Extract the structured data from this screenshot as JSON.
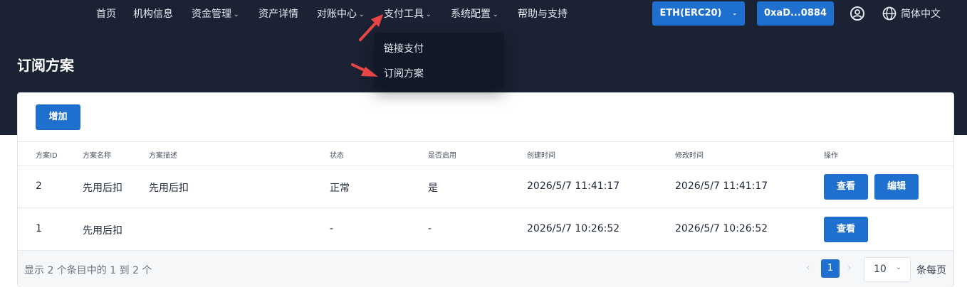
{
  "nav": {
    "items": [
      {
        "label": "首页"
      },
      {
        "label": "机构信息"
      },
      {
        "label": "资金管理",
        "caret": "⌄"
      },
      {
        "label": "资产详情"
      },
      {
        "label": "对账中心",
        "caret": "⌄"
      },
      {
        "label": "支付工具",
        "caret": "⌄"
      },
      {
        "label": "系统配置",
        "caret": "⌄"
      },
      {
        "label": "帮助与支持"
      }
    ],
    "network": {
      "label": "ETH(ERC20)",
      "caret": "⌄"
    },
    "wallet": {
      "label": "0xaD...0884"
    },
    "language": {
      "label": "简体中文",
      "icon": "globe-icon"
    },
    "user_icon": "user-circle-icon"
  },
  "dropdown": {
    "items": [
      {
        "label": "链接支付"
      },
      {
        "label": "订阅方案"
      }
    ]
  },
  "page": {
    "title": "订阅方案"
  },
  "toolbar": {
    "add_label": "增加"
  },
  "table": {
    "headers": [
      "方案ID",
      "方案名称",
      "方案描述",
      "状态",
      "是否启用",
      "创建时间",
      "修改时间",
      "操作"
    ],
    "rows": [
      {
        "id": "2",
        "name": "先用后扣",
        "desc": "先用后扣",
        "status": "正常",
        "enabled": "是",
        "created": "2026/5/7 11:41:17",
        "modified": "2026/5/7 11:41:17",
        "actions": [
          "查看",
          "编辑"
        ]
      },
      {
        "id": "1",
        "name": "先用后扣",
        "desc": "",
        "status": "-",
        "enabled": "-",
        "created": "2026/5/7 10:26:52",
        "modified": "2026/5/7 10:26:52",
        "actions": [
          "查看"
        ]
      }
    ]
  },
  "pagination": {
    "summary": "显示 2 个条目中的 1 到 2 个",
    "current_page": "1",
    "prev": "‹",
    "next": "›",
    "page_size": "10",
    "page_size_caret": "⌄",
    "per_page_label": "条每页"
  },
  "colors": {
    "accent": "#1f6fcf",
    "header_bg": "#1a2233",
    "annotation": "#e84545"
  }
}
